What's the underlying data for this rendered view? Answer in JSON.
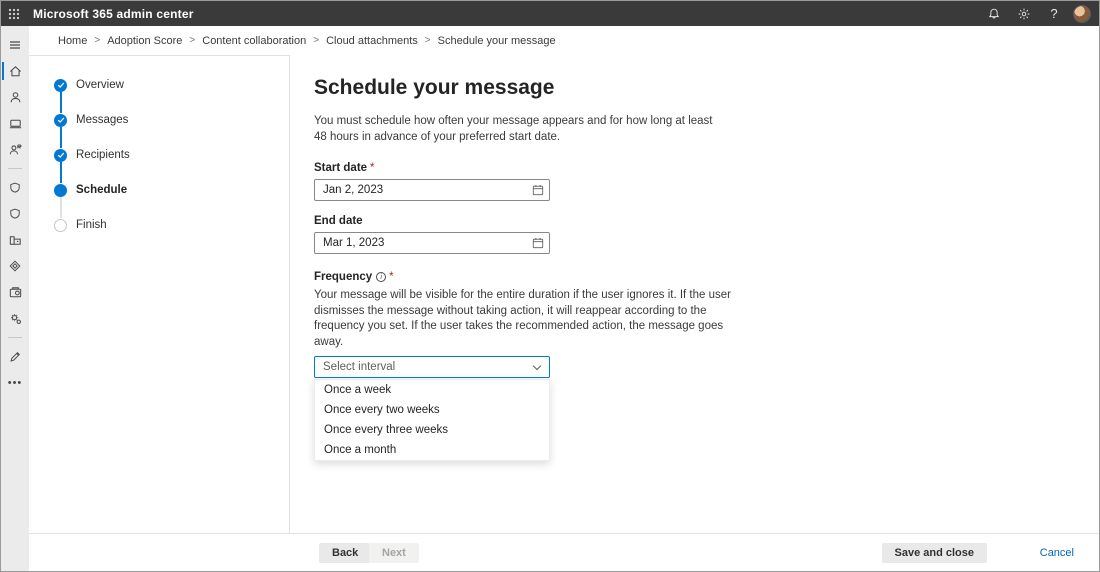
{
  "top_bar": {
    "title": "Microsoft 365 admin center",
    "icons": [
      "waffle-icon",
      "bell-icon",
      "gear-icon",
      "help-icon",
      "user-avatar"
    ]
  },
  "breadcrumb": {
    "separator": ">",
    "items": [
      "Home",
      "Adoption Score",
      "Content collaboration",
      "Cloud attachments",
      "Schedule your message"
    ]
  },
  "nav_rail": {
    "icons": [
      "menu-icon",
      "home-icon",
      "users-icon",
      "devices-icon",
      "roles-icon",
      "shield-icon",
      "shield-checkmark-icon",
      "org-icon",
      "billing-icon",
      "marketplace-icon",
      "settings-icon",
      "edit-icon",
      "more-icon"
    ],
    "selected": "home"
  },
  "wizard": {
    "steps": [
      {
        "label": "Overview",
        "state": "completed"
      },
      {
        "label": "Messages",
        "state": "completed"
      },
      {
        "label": "Recipients",
        "state": "completed"
      },
      {
        "label": "Schedule",
        "state": "current"
      },
      {
        "label": "Finish",
        "state": "upcoming"
      }
    ]
  },
  "main": {
    "title": "Schedule your message",
    "intro": "You must schedule how often your message appears and for how long at least 48 hours in advance of your preferred start date.",
    "start_date": {
      "label": "Start date",
      "required_mark": "*",
      "value": "Jan 2, 2023"
    },
    "end_date": {
      "label": "End date",
      "value": "Mar 1, 2023"
    },
    "frequency": {
      "label": "Frequency",
      "required_mark": "*",
      "info_glyph": "i",
      "description": "Your message will be visible for the entire duration if the user ignores it. If the user dismisses the message without taking action, it will reappear according to the frequency you set. If the user takes the recommended action, the message goes away.",
      "placeholder": "Select interval",
      "options": [
        "Once a week",
        "Once every two weeks",
        "Once every three weeks",
        "Once a month"
      ]
    }
  },
  "footer": {
    "back_label": "Back",
    "next_label": "Next",
    "save_and_close_label": "Save and close",
    "cancel_label": "Cancel"
  },
  "colors": {
    "accent": "#0078d4",
    "topbar_background": "#3a3a3a",
    "required_asterisk": "#a4262c",
    "cancel_link": "#0067b8"
  }
}
